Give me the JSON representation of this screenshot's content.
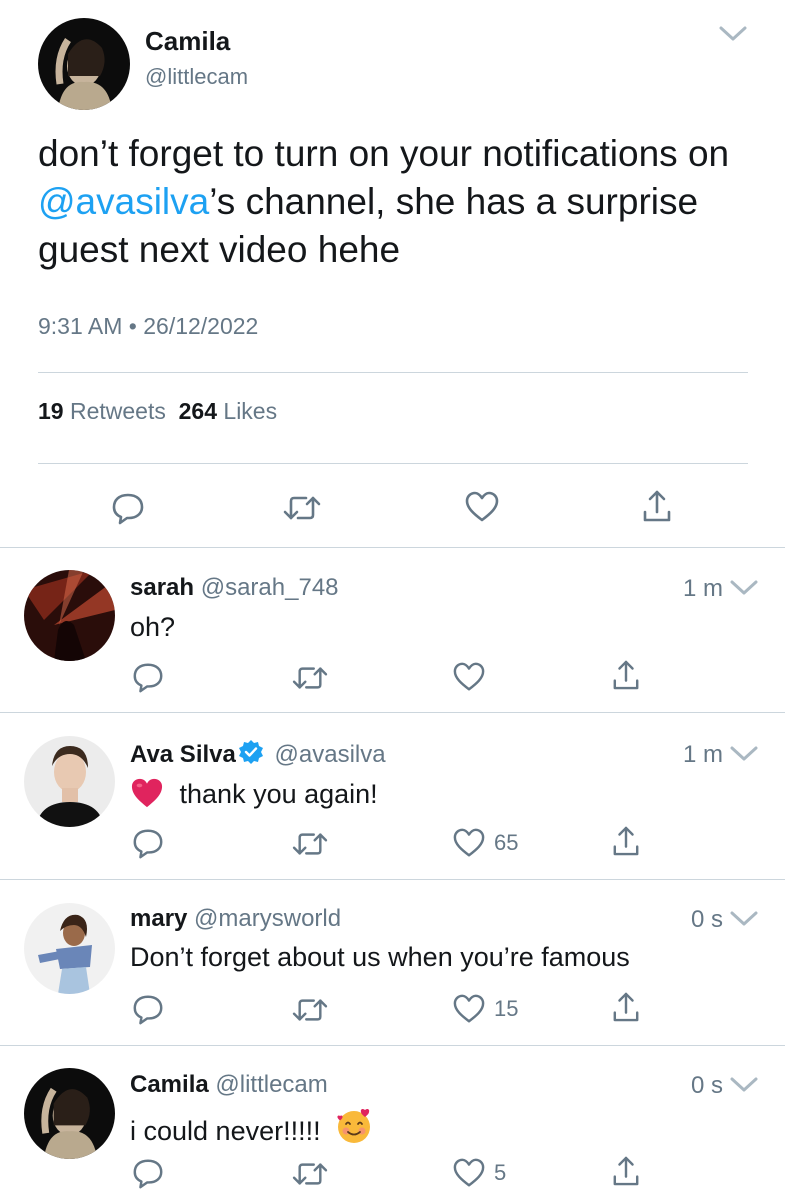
{
  "main_tweet": {
    "name": "Camila",
    "handle": "@littlecam",
    "text_part1": "don’t forget to turn on your notifications on ",
    "mention": "@avasilva",
    "text_part2": "’s channel, she has a surprise guest next video hehe",
    "time": "9:31 AM",
    "separator": "•",
    "date": "26/12/2022",
    "retweets_count": "19",
    "retweets_label": "Retweets",
    "likes_count": "264",
    "likes_label": "Likes",
    "icons": [
      "reply-icon",
      "retweet-icon",
      "like-icon",
      "share-icon"
    ]
  },
  "replies": [
    {
      "name": "sarah",
      "handle": "@sarah_748",
      "time": "1 m",
      "text": "oh?",
      "likes": ""
    },
    {
      "name": "Ava Silva",
      "verified": true,
      "handle": "@avasilva",
      "time": "1 m",
      "emoji": "heart-emoji",
      "text": "thank you again!",
      "likes": "65"
    },
    {
      "name": "mary",
      "handle": "@marysworld",
      "time": "0 s",
      "text": "Don’t forget about us when you’re famous",
      "likes": "15"
    },
    {
      "name": "Camila",
      "handle": "@littlecam",
      "time": "0 s",
      "text": "i could never!!!!!",
      "emoji": "smiling-face-with-hearts-emoji",
      "likes": "5"
    }
  ],
  "colors": {
    "accent": "#1da1f2",
    "secondary_text": "#657786",
    "divider": "#ccd6dd",
    "heart_emoji": "#e0245e"
  }
}
